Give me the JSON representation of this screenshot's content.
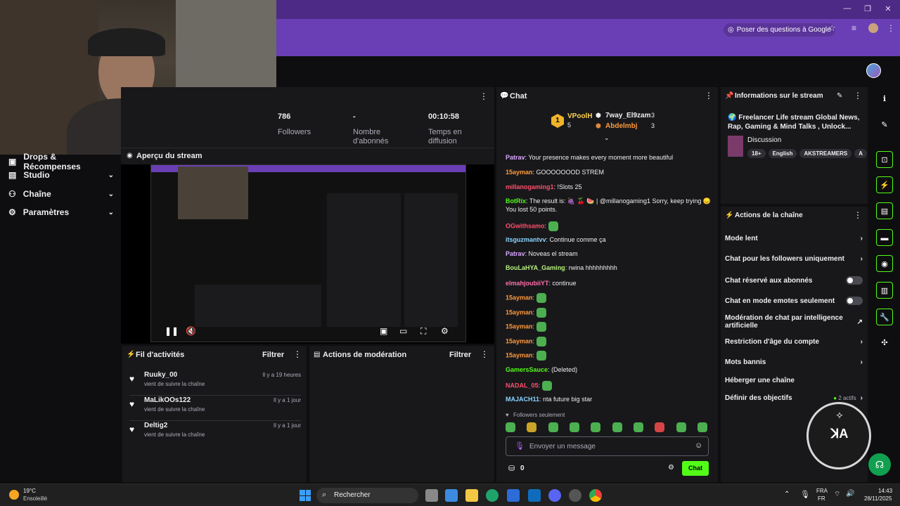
{
  "browser": {
    "ask_google": "Poser des questions à Google",
    "window_controls": [
      "—",
      "❐",
      "✕"
    ]
  },
  "nav": {
    "items": [
      {
        "label": "Drops & Récompenses"
      },
      {
        "label": "Studio"
      },
      {
        "label": "Chaîne"
      },
      {
        "label": "Paramètres"
      }
    ]
  },
  "stats": [
    {
      "value": "786",
      "label": "Followers"
    },
    {
      "value": "-",
      "label": "Nombre d'abonnés"
    },
    {
      "value": "00:10:58",
      "label": "Temps en diffusion"
    }
  ],
  "preview": {
    "title": "Aperçu du stream"
  },
  "activity": {
    "title": "Fil d'activités",
    "filter": "Filtrer",
    "items": [
      {
        "name": "Ruuky_00",
        "sub": "vient de suivre la chaîne",
        "time": "Il y a 19 heures"
      },
      {
        "name": "MaLikOOs122",
        "sub": "vient de suivre la chaîne",
        "time": "Il y a 1 jour"
      },
      {
        "name": "Deltig2",
        "sub": "vient de suivre la chaîne",
        "time": "Il y a 1 jour"
      }
    ]
  },
  "moderation": {
    "title": "Actions de modération",
    "filter": "Filtrer"
  },
  "chat": {
    "title": "Chat",
    "leaders": [
      {
        "rank": "1",
        "name": "VPoolH",
        "score": "5"
      },
      {
        "name": "7way_El9zam",
        "score": "3"
      },
      {
        "name": "Abdelmbj",
        "score": "3"
      }
    ],
    "messages": [
      {
        "user": "Patrav",
        "color": "#d9a6ff",
        "text": "Your presence makes every moment more beautiful"
      },
      {
        "user": "15ayman",
        "color": "#ff9a3c",
        "text": "GOOOOOOOD STREM"
      },
      {
        "user": "millanogaming1",
        "color": "#ff4f6b",
        "text": "!Slots 25"
      },
      {
        "user": "BotRix",
        "color": "#53fc18",
        "text": "The result is: 🍇 🍒 🍉 | @millanogaming1 Sorry, keep trying 😞 You lost 50 points."
      },
      {
        "user": "OGwithsamo",
        "color": "#ff4f6b",
        "text": ""
      },
      {
        "user": "itsguzmantvv",
        "color": "#8ad4ff",
        "text": "Continue comme ça"
      },
      {
        "user": "Patrav",
        "color": "#d9a6ff",
        "text": "Noveas el stream"
      },
      {
        "user": "BouLaHYA_Gaming",
        "color": "#b6f07a",
        "text": "rwina hhhhhhhhh"
      },
      {
        "user": "elmahjoubiiYT",
        "color": "#ff6fa8",
        "text": "continue"
      },
      {
        "user": "15ayman",
        "color": "#ff9a3c",
        "text": ""
      },
      {
        "user": "15ayman",
        "color": "#ff9a3c",
        "text": ""
      },
      {
        "user": "15ayman",
        "color": "#ff9a3c",
        "text": ""
      },
      {
        "user": "15ayman",
        "color": "#ff9a3c",
        "text": ""
      },
      {
        "user": "15ayman",
        "color": "#ff9a3c",
        "text": ""
      },
      {
        "user": "GamersSauce",
        "color": "#53fc18",
        "text": "(Deleted)"
      },
      {
        "user": "NADAL_05",
        "color": "#ff4f6b",
        "text": ""
      },
      {
        "user": "MAJACH11",
        "color": "#8ad4ff",
        "text": "nta future big star"
      }
    ],
    "followers_only": "Followers seulement",
    "input_placeholder": "Envoyer un message",
    "points": "0",
    "send_label": "Chat"
  },
  "stream_info": {
    "title": "Informations sur le stream",
    "stream_title": "🌍 Freelancer Life stream Global News, Rap, Gaming & Mind Talks , Unlock...",
    "category": "Discussion",
    "tags": [
      "18+",
      "English",
      "AKSTREAMERS",
      "A"
    ]
  },
  "actions": {
    "title": "Actions de la chaîne",
    "items": [
      {
        "label": "Mode lent"
      },
      {
        "label": "Chat pour les followers uniquement"
      },
      {
        "label": "Chat réservé aux abonnés"
      },
      {
        "label": "Chat en mode emotes seulement"
      },
      {
        "label": "Modération de chat par intelligence artificielle"
      },
      {
        "label": "Restriction d'âge du compte"
      },
      {
        "label": "Mots bannis"
      },
      {
        "label": "Héberger une chaîne"
      },
      {
        "label": "Définir des objectifs"
      }
    ],
    "goals_active": "2 actifs"
  },
  "taskbar": {
    "weather_temp": "19°C",
    "weather_desc": "Ensoleillé",
    "search": "Rechercher",
    "lang_top": "FRA",
    "lang_bottom": "FR",
    "time": "14:43",
    "date": "28/11/2025"
  }
}
